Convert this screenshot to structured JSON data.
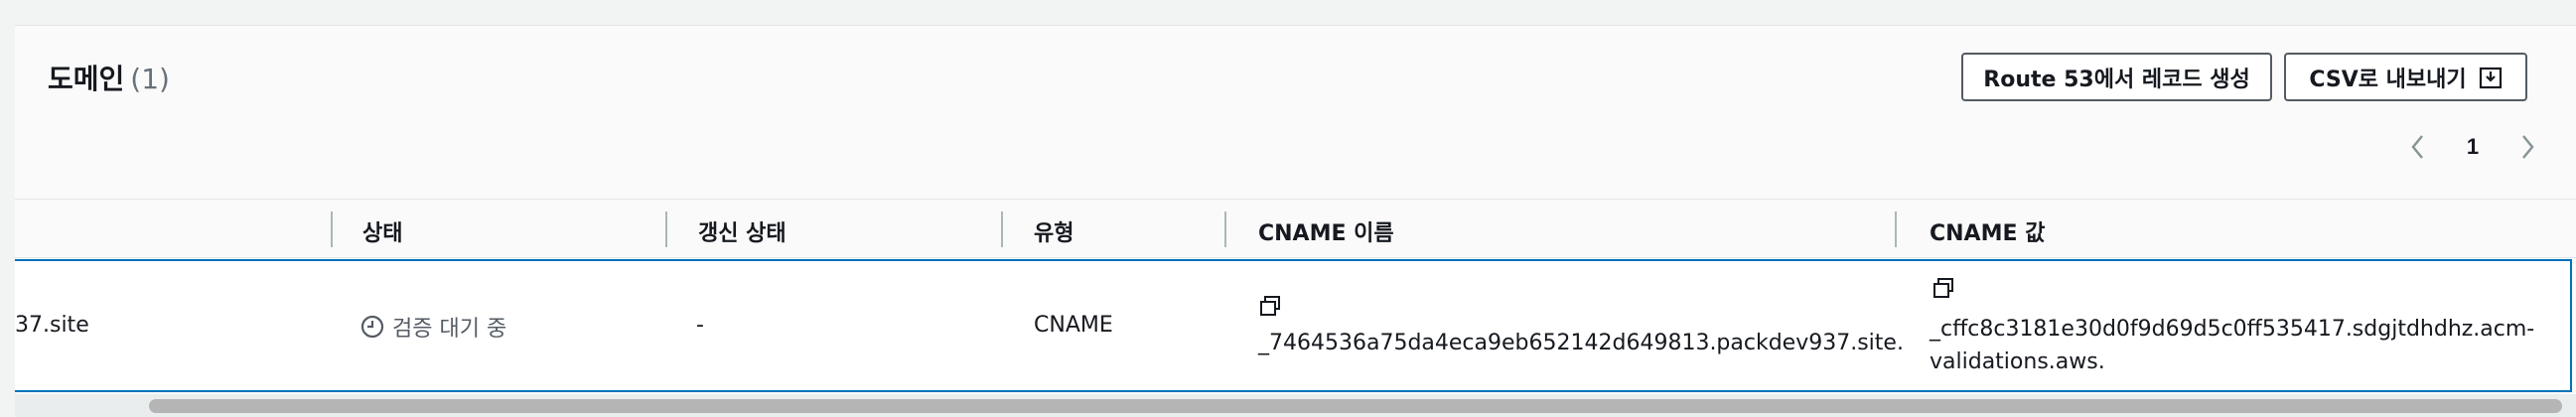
{
  "section": {
    "title": "도메인",
    "count": "(1)"
  },
  "buttons": {
    "route53": "Route 53에서 레코드 생성",
    "csv": "CSV로 내보내기"
  },
  "pagination": {
    "current_page": "1"
  },
  "columns": [
    "상태",
    "갱신 상태",
    "유형",
    "CNAME 이름",
    "CNAME 값"
  ],
  "rows": [
    {
      "domain_fragment": "37.site",
      "status": "검증 대기 중",
      "renewal_status": "-",
      "type": "CNAME",
      "cname_name": "_7464536a75da4eca9eb652142d649813.packdev937.site.",
      "cname_value_line1": "_cffc8c3181e30d0f9d69d5c0ff535417.sdgjtdhdhz.acm-",
      "cname_value_line2": "validations.aws."
    }
  ],
  "colors": {
    "selected_border": "#0073bb",
    "button_border": "#545b64",
    "muted_text": "#687078"
  },
  "icons": [
    "chevron-left-icon",
    "chevron-right-icon",
    "download-icon",
    "clock-icon",
    "copy-icon"
  ]
}
